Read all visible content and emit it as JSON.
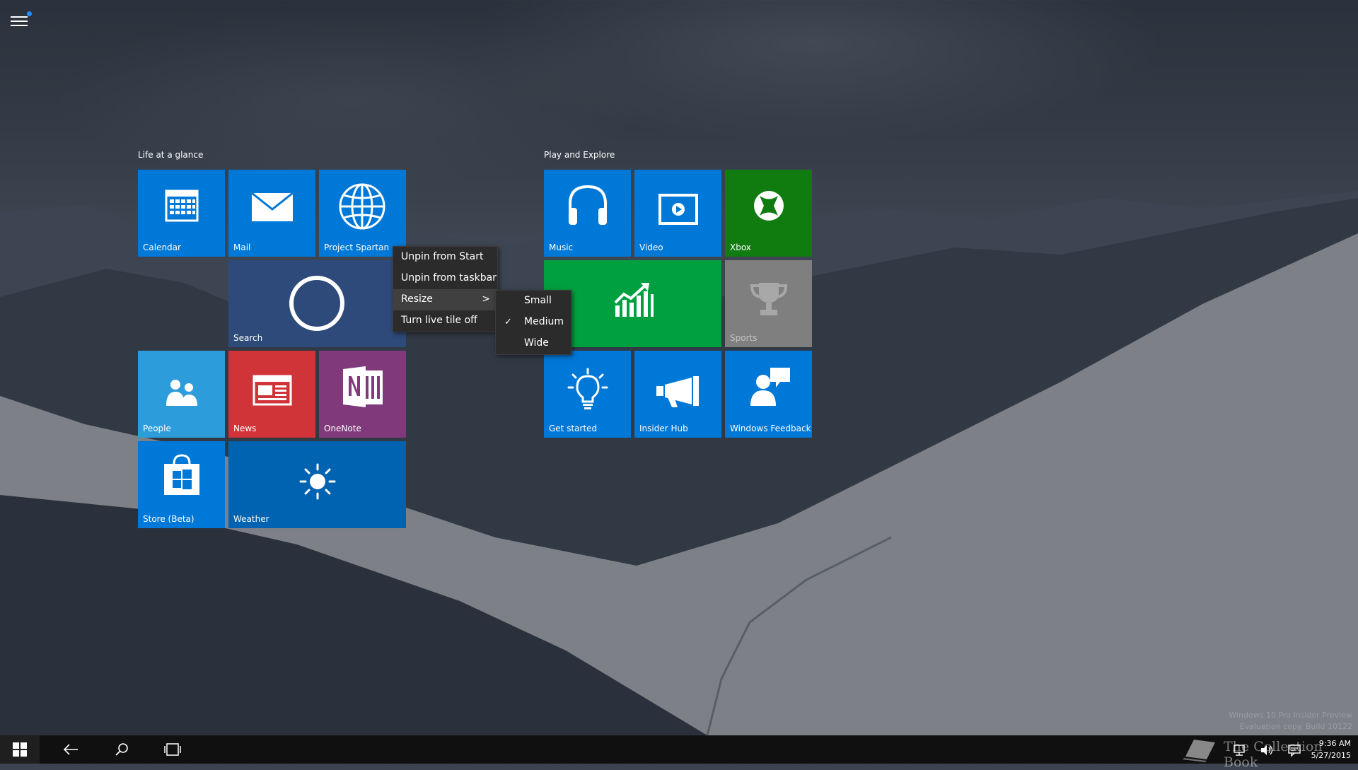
{
  "groups": [
    {
      "title": "Life at a glance"
    },
    {
      "title": "Play and Explore"
    }
  ],
  "tiles": {
    "calendar": {
      "label": "Calendar",
      "color": "#0078d7",
      "icon": "calendar-icon"
    },
    "mail": {
      "label": "Mail",
      "color": "#0078d7",
      "icon": "mail-icon"
    },
    "spartan": {
      "label": "Project Spartan",
      "color": "#0078d7",
      "icon": "globe-icon"
    },
    "search": {
      "label": "Search",
      "color": "#2e4a7a",
      "icon": "cortana-circle-icon"
    },
    "people": {
      "label": "People",
      "color": "#2d9cdb",
      "icon": "people-icon"
    },
    "news": {
      "label": "News",
      "color": "#d13438",
      "icon": "news-icon"
    },
    "onenote": {
      "label": "OneNote",
      "color": "#80397b",
      "icon": "onenote-icon"
    },
    "store": {
      "label": "Store (Beta)",
      "color": "#0078d7",
      "icon": "store-bag-icon"
    },
    "weather": {
      "label": "Weather",
      "color": "#0063b1",
      "icon": "sun-icon"
    },
    "music": {
      "label": "Music",
      "color": "#0078d7",
      "icon": "headphones-icon"
    },
    "video": {
      "label": "Video",
      "color": "#0078d7",
      "icon": "video-play-icon"
    },
    "xbox": {
      "label": "Xbox",
      "color": "#107c10",
      "icon": "xbox-logo-icon"
    },
    "money": {
      "label": "y",
      "color": "#00a040",
      "icon": "chart-growth-icon"
    },
    "sports": {
      "label": "Sports",
      "color": "#7f7f7f",
      "icon": "trophy-icon"
    },
    "getstarted": {
      "label": "Get started",
      "color": "#0078d7",
      "icon": "lightbulb-icon"
    },
    "insiderhub": {
      "label": "Insider Hub",
      "color": "#0078d7",
      "icon": "megaphone-icon"
    },
    "feedback": {
      "label": "Windows Feedback",
      "color": "#0078d7",
      "icon": "feedback-person-icon"
    }
  },
  "context_menu": {
    "unpin_start": "Unpin from Start",
    "unpin_taskbar": "Unpin from taskbar",
    "resize": "Resize",
    "live_tile_off": "Turn live tile off",
    "submenu_arrow": ">"
  },
  "resize_menu": {
    "small": "Small",
    "medium": "Medium",
    "wide": "Wide",
    "selected": "Medium",
    "check": "✓"
  },
  "taskbar": {
    "time": "9:36 AM",
    "date": "5/27/2015"
  },
  "watermark": {
    "line1": "Windows 10 Pro Insider Preview",
    "line2": "Evaluation copy. Build 10122"
  },
  "brand_overlay": "The Collection Book"
}
